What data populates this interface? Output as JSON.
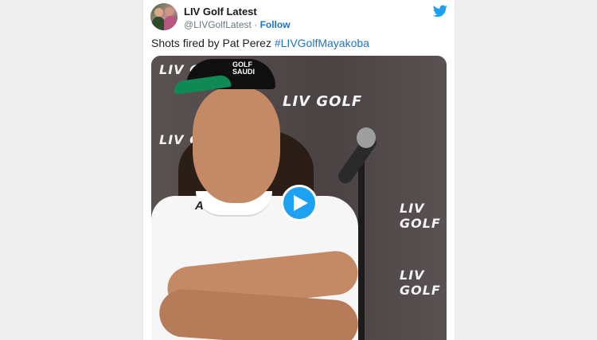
{
  "tweet": {
    "author_name": "LIV Golf Latest",
    "handle": "@LIVGolfLatest",
    "separator": " · ",
    "follow_label": "Follow",
    "text": "Shots fired by Pat Perez ",
    "hashtag": "#LIVGolfMayakoba"
  },
  "media": {
    "backdrop_logo": "LIV GOLF",
    "cap_text_line1": "GOLF",
    "cap_text_line2": "SAUDI",
    "shirt_logo": "A",
    "play_icon": "play-icon"
  },
  "colors": {
    "link": "#1b74c8",
    "twitter_blue": "#1da1f2",
    "text": "#1c2022"
  },
  "icons": [
    "twitter-bird-icon",
    "play-icon"
  ]
}
